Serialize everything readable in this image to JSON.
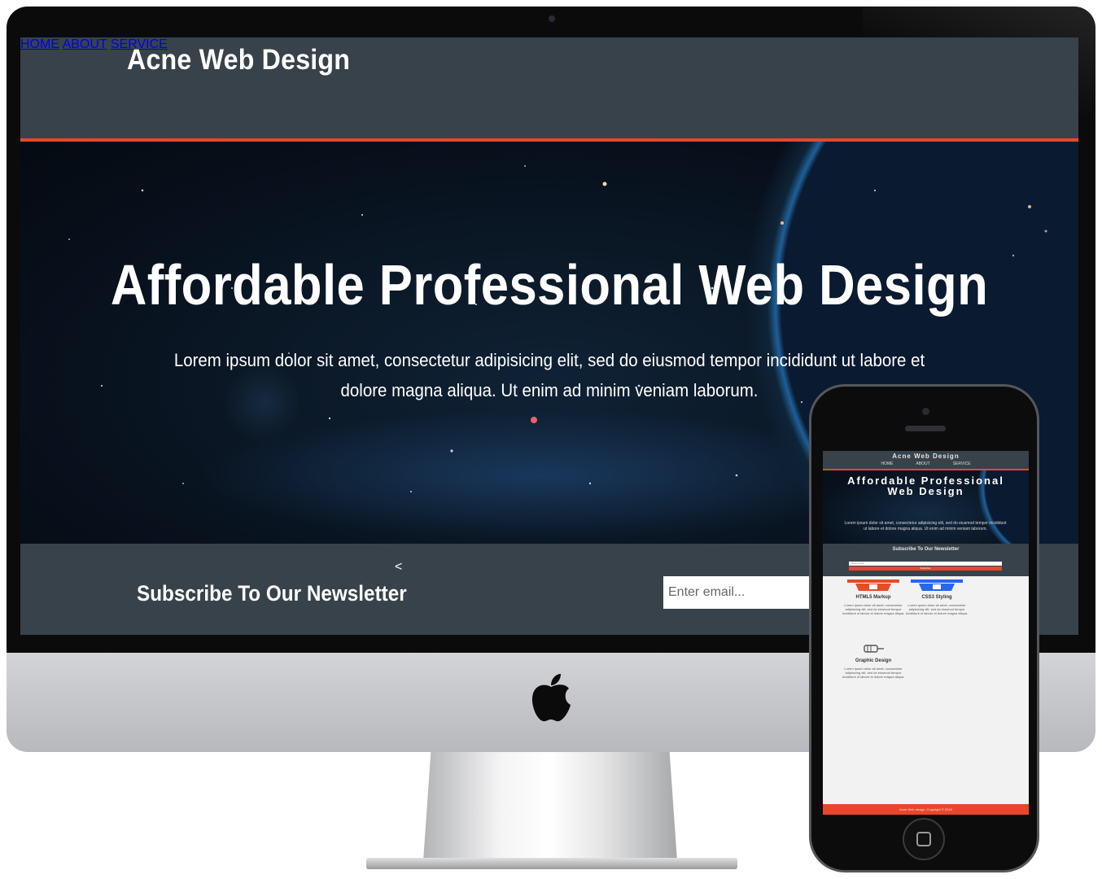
{
  "site": {
    "brand": "Acne Web Design",
    "nav": [
      "HOME",
      "ABOUT",
      "SERVICE"
    ],
    "hero": {
      "title": "Affordable Professional Web Design",
      "text": "Lorem ipsum dolor sit amet, consectetur adipisicing elit, sed do eiusmod tempor incididunt ut labore et dolore magna aliqua. Ut enim ad minim veniam laborum."
    },
    "newsletter": {
      "caret": "<",
      "title": "Subscribe To Our Newsletter",
      "input_placeholder": "Enter email..."
    }
  },
  "mobile": {
    "brand": "Acne Web Design",
    "nav": [
      "HOME",
      "ABOUT",
      "SERVICE"
    ],
    "hero_title": "Affordable Professional Web Design",
    "hero_text": "Lorem ipsum dolor sit amet, consectetur adipisicing elit, sed do eiusmod tempor incididunt ut labore et dolore magna aliqua. Ut enim ad minim veniam laborum.",
    "newsletter_title": "Subscribe To Our Newsletter",
    "input_placeholder": "Enter email...",
    "button_label": "Subscribe",
    "boxes": [
      {
        "icon": "html5-icon",
        "title": "HTML5 Markup",
        "text": "Lorem ipsum dolor sit amet, consectetur adipisicing elit, sed do eiusmod tempor incididunt ut labore et dolore magna aliqua."
      },
      {
        "icon": "css3-icon",
        "title": "CSS3 Styling",
        "text": "Lorem ipsum dolor sit amet, consectetur adipisicing elit, sed do eiusmod tempor incididunt ut labore et dolore magna aliqua."
      },
      {
        "icon": "brush-icon",
        "title": "Graphic Design",
        "text": "Lorem ipsum dolor sit amet, consectetur adipisicing elit, sed do eiusmod tempor incididunt ut labore et dolore magna aliqua."
      }
    ],
    "footer": "Acne Web design, Copyright © 2018"
  },
  "colors": {
    "header_bg": "#37424b",
    "accent": "#e9462b",
    "html5": "#e44d26",
    "css3": "#2965f1"
  }
}
